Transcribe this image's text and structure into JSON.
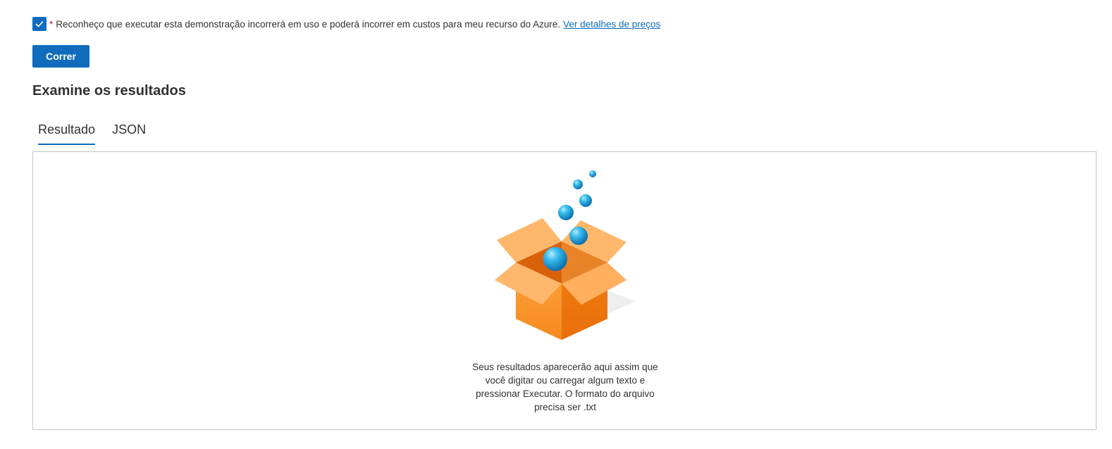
{
  "consent": {
    "required_marker": "*",
    "text": "Reconheço que executar esta demonstração incorrerá em uso e poderá incorrer em custos para meu recurso do Azure.",
    "link_label": "Ver detalhes de preços",
    "checked": true
  },
  "actions": {
    "run_label": "Correr"
  },
  "results": {
    "title": "Examine os resultados",
    "tabs": [
      {
        "label": "Resultado",
        "active": true
      },
      {
        "label": "JSON",
        "active": false
      }
    ],
    "empty_message": "Seus resultados aparecerão aqui assim que você digitar ou carregar algum texto e pressionar Executar. O formato do arquivo precisa ser .txt"
  },
  "colors": {
    "accent": "#0f6cbd",
    "required": "#a4262c",
    "box_orange": "#f7891f",
    "bubble_blue": "#1fa3e0"
  },
  "icons": {
    "checkbox": "checkmark-icon",
    "illustration": "open-box-illustration"
  }
}
